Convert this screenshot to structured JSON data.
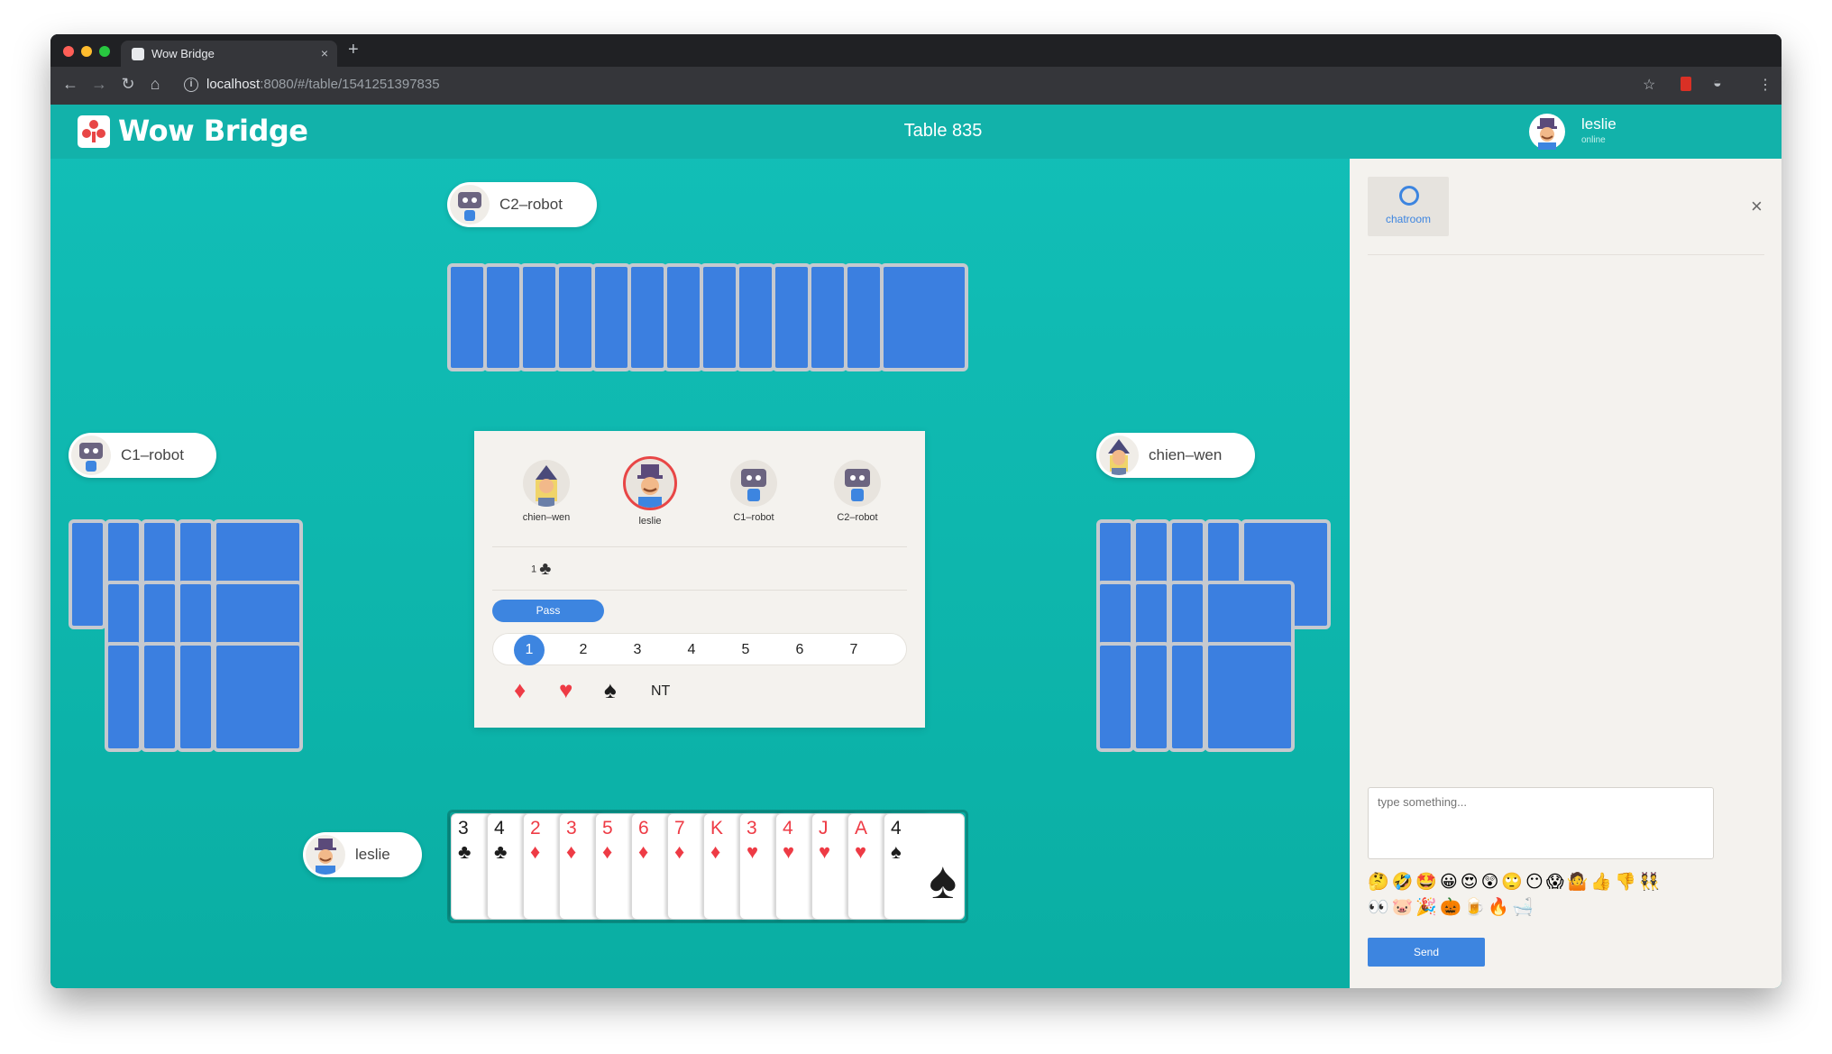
{
  "browser": {
    "tab_title": "Wow Bridge",
    "tab_close": "×",
    "new_tab": "+",
    "url_host": "localhost",
    "url_rest": ":8080/#/table/1541251397835",
    "info_icon": "i"
  },
  "header": {
    "logo_text": "Wow Bridge",
    "table_title": "Table 835",
    "user_name": "leslie",
    "user_status": "online"
  },
  "players": {
    "north": "C2–robot",
    "west": "C1–robot",
    "east": "chien–wen",
    "south": "leslie"
  },
  "bidding": {
    "players": [
      "chien–wen",
      "leslie",
      "C1–robot",
      "C2–robot"
    ],
    "history_level": "1",
    "history_suit": "♣",
    "pass_label": "Pass",
    "levels": [
      "1",
      "2",
      "3",
      "4",
      "5",
      "6",
      "7"
    ],
    "selected_level": "1",
    "suits": {
      "diamond": "♦",
      "heart": "♥",
      "spade": "♠"
    },
    "nt_label": "NT"
  },
  "hand": [
    {
      "rank": "3",
      "suit": "♣",
      "color": "black"
    },
    {
      "rank": "4",
      "suit": "♣",
      "color": "black"
    },
    {
      "rank": "2",
      "suit": "♦",
      "color": "red"
    },
    {
      "rank": "3",
      "suit": "♦",
      "color": "red"
    },
    {
      "rank": "5",
      "suit": "♦",
      "color": "red"
    },
    {
      "rank": "6",
      "suit": "♦",
      "color": "red"
    },
    {
      "rank": "7",
      "suit": "♦",
      "color": "red"
    },
    {
      "rank": "K",
      "suit": "♦",
      "color": "red"
    },
    {
      "rank": "3",
      "suit": "♥",
      "color": "red"
    },
    {
      "rank": "4",
      "suit": "♥",
      "color": "red"
    },
    {
      "rank": "J",
      "suit": "♥",
      "color": "red"
    },
    {
      "rank": "A",
      "suit": "♥",
      "color": "red"
    },
    {
      "rank": "4",
      "suit": "♠",
      "color": "black"
    }
  ],
  "colors": {
    "teal": "#12bfb8",
    "card_back": "#3b7fe0",
    "accent_blue": "#3d85e0",
    "active_red": "#e84646"
  },
  "chat": {
    "tab_label": "chatroom",
    "close": "×",
    "placeholder": "type something...",
    "emoji_row1": "🤔🤣🤩😀😍😲🙄😶😱🤷👍👎👯",
    "emoji_row2": "👀🐷🎉🎃🍺🔥🛁",
    "send_label": "Send"
  }
}
